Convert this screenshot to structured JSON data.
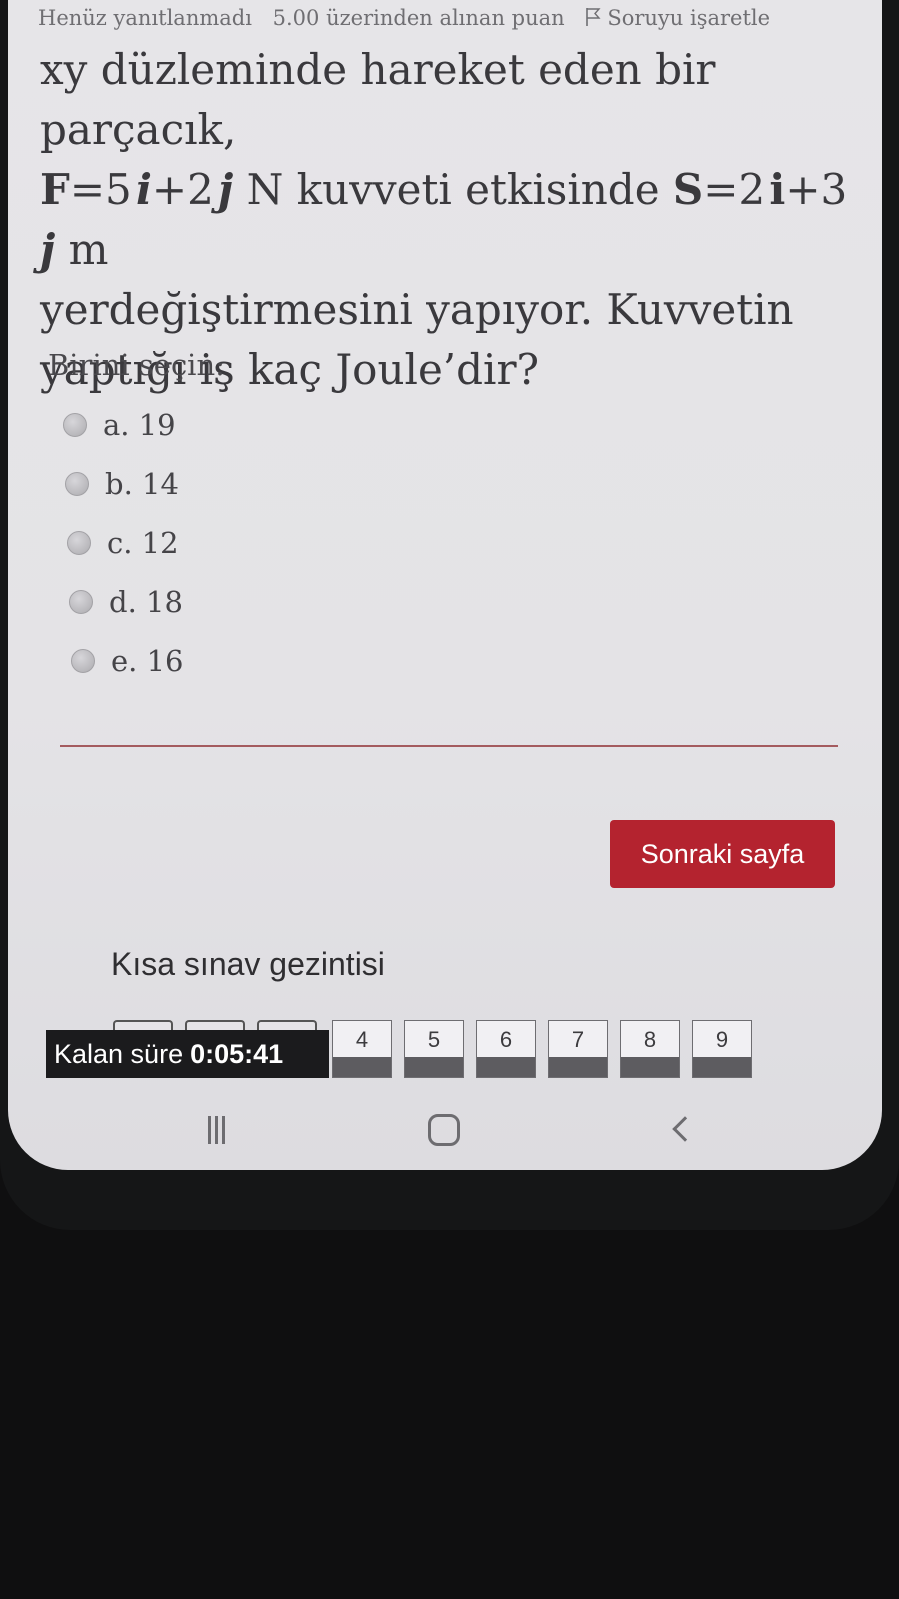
{
  "header": {
    "status": "Henüz yanıtlanmadı",
    "points": "5.00 üzerinden alınan puan",
    "flag_label": "Soruyu işaretle"
  },
  "question": {
    "line1": "xy düzleminde hareket eden bir parçacık,",
    "line2": {
      "f_symbol": "F",
      "f_eq_5": "=5",
      "i1": "i",
      "plus2": "+2",
      "j1": "j",
      "n_text": "N kuvveti etkisinde",
      "s_symbol": "S",
      "s_eq_2": "=2",
      "i2": "i",
      "plus3": "+3",
      "j2": "j",
      "m_unit": "m"
    },
    "line3": "yerdeğiştirmesini yapıyor. Kuvvetin",
    "line4": "yaptığı iş kaç Joule’dir?"
  },
  "prompt": "Birini seçin:",
  "options": [
    {
      "label": "a. 19"
    },
    {
      "label": "b. 14"
    },
    {
      "label": "c. 12"
    },
    {
      "label": "d. 18"
    },
    {
      "label": "e. 16"
    }
  ],
  "next_button": "Sonraki sayfa",
  "quiz_nav": {
    "title": "Kısa sınav gezintisi",
    "timer_label": "Kalan süre",
    "timer_value": "0:05:41",
    "questions": [
      "4",
      "5",
      "6",
      "7",
      "8",
      "9"
    ]
  },
  "colors": {
    "accent": "#b4232f",
    "divider": "#a45b5f",
    "timer_bg": "#1b1b1d"
  },
  "icons": [
    "flag-icon",
    "recents-icon",
    "home-icon",
    "back-icon"
  ]
}
